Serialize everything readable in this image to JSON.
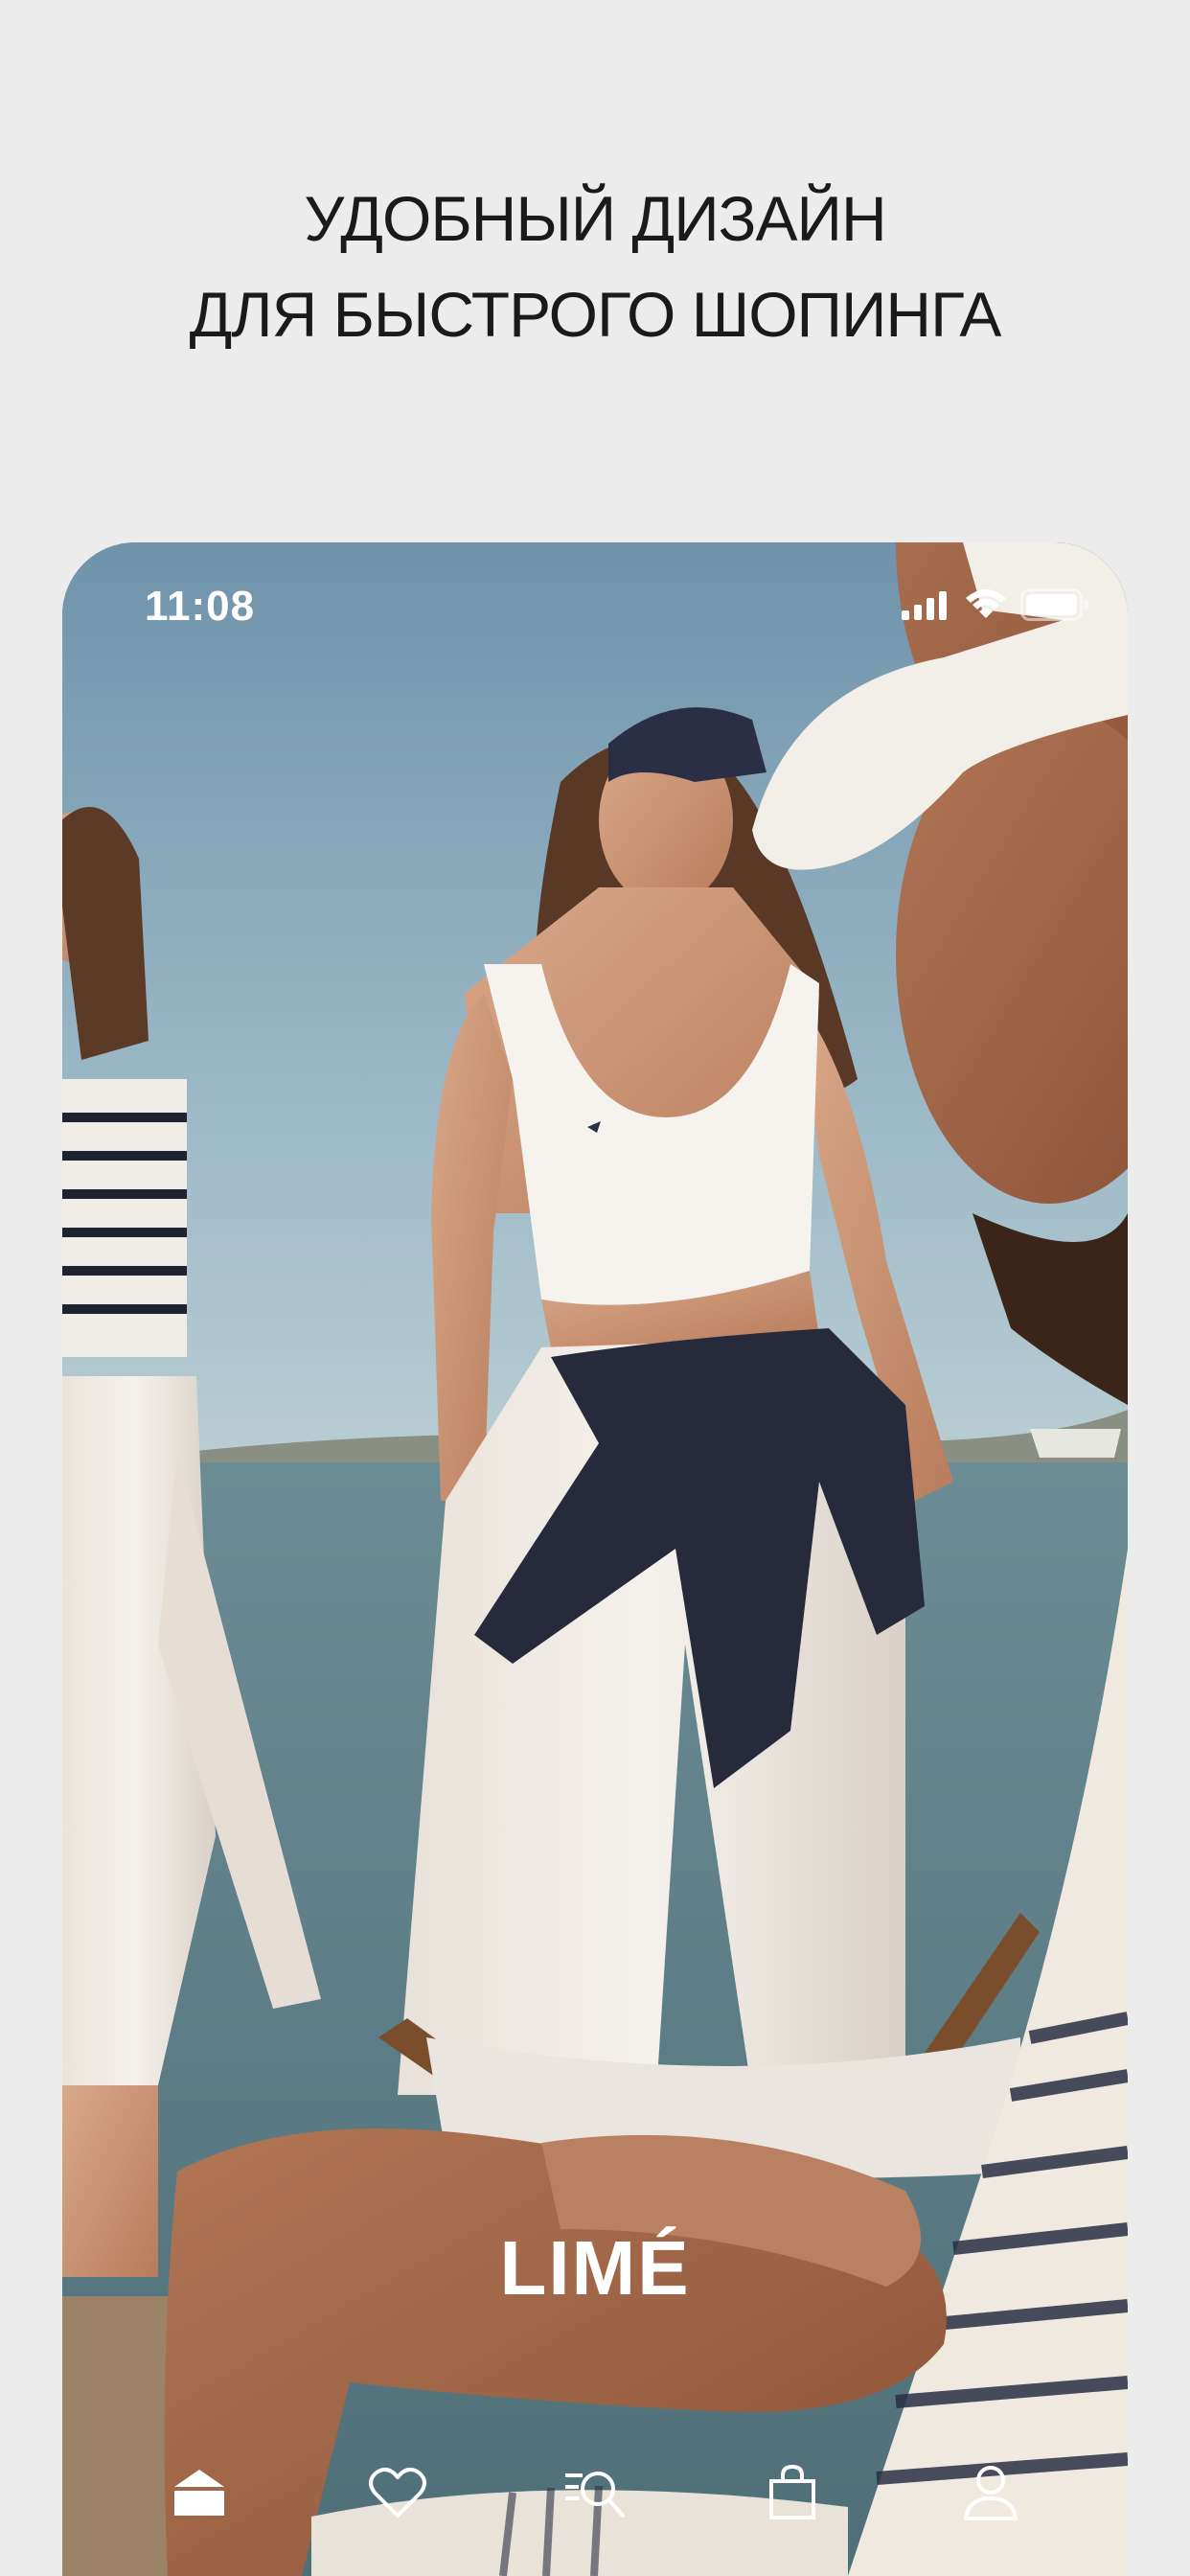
{
  "promo": {
    "line1": "УДОБНЫЙ ДИЗАЙН",
    "line2": "ДЛЯ БЫСТРОГО ШОПИНГА"
  },
  "status_bar": {
    "time": "11:08",
    "icons": [
      "cellular-signal-icon",
      "wifi-icon",
      "battery-icon"
    ]
  },
  "brand": {
    "logo_text": "LIMÉ"
  },
  "tab_bar": {
    "tabs": [
      {
        "icon": "home-icon",
        "active": true
      },
      {
        "icon": "heart-icon",
        "active": false
      },
      {
        "icon": "catalog-search-icon",
        "active": false
      },
      {
        "icon": "shopping-bag-icon",
        "active": false
      },
      {
        "icon": "profile-icon",
        "active": false
      }
    ]
  },
  "colors": {
    "page_background": "#ececec",
    "headline_text": "#1a1a1a",
    "sky": "#7fa0b6",
    "sea": "#5e7f8a",
    "ui_white": "#ffffff"
  }
}
